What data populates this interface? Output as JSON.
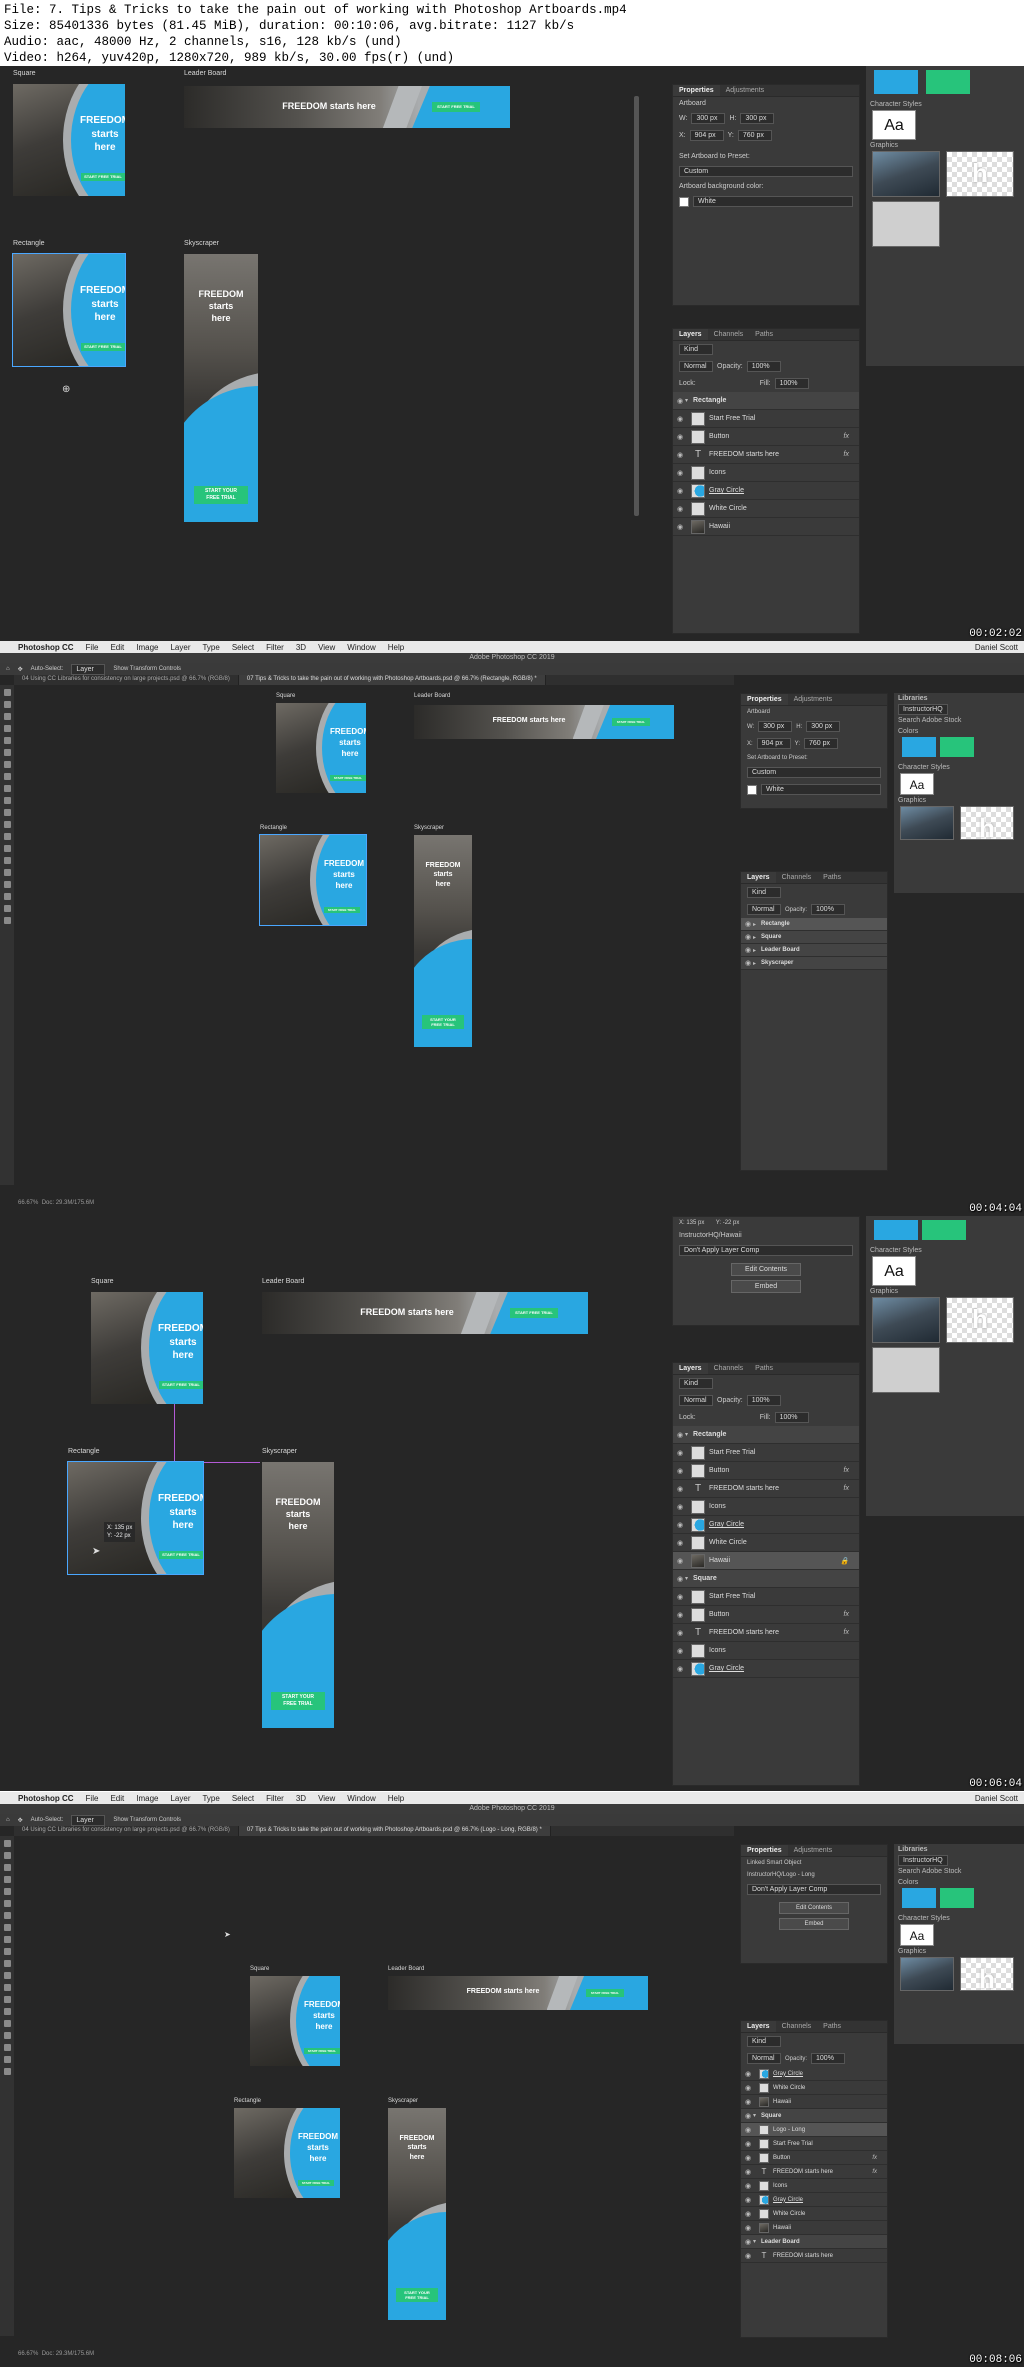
{
  "info": {
    "line1": "File: 7. Tips & Tricks to take the pain out of working with Photoshop Artboards.mp4",
    "line2": "Size: 85401336 bytes (81.45 MiB), duration: 00:10:06, avg.bitrate: 1127 kb/s",
    "line3": "Audio: aac, 48000 Hz, 2 channels, s16, 128 kb/s (und)",
    "line4": "Video: h264, yuv420p, 1280x720, 989 kb/s, 30.00 fps(r) (und)"
  },
  "menubar": {
    "app": "Photoshop CC",
    "items": [
      "File",
      "Edit",
      "Image",
      "Layer",
      "Type",
      "Select",
      "Filter",
      "3D",
      "View",
      "Window",
      "Help"
    ],
    "user": "Daniel Scott"
  },
  "window_title": "Adobe Photoshop CC 2019",
  "doc_tabs": {
    "tab1": "04 Using CC Libraries for consistency on large projects.psd @ 66.7% (RGB/8)",
    "tab2_frame2": "07 Tips & Tricks to take the pain out of working with Photoshop Artboards.psd @ 66.7% (Rectangle, RGB/8) *",
    "tab2_frame4": "07 Tips & Tricks to take the pain out of working with Photoshop Artboards.psd @ 66.7% (Logo - Long, RGB/8) *"
  },
  "options_bar": {
    "auto_select": "Auto-Select:",
    "layer": "Layer",
    "show_transform": "Show Transform Controls"
  },
  "artboards": {
    "square_label": "Square",
    "leader_label": "Leader Board",
    "rectangle_label": "Rectangle",
    "skyscraper_label": "Skyscraper",
    "headline_l1": "FREEDOM",
    "headline_l2": "starts",
    "headline_l3": "here",
    "leader_headline": "FREEDOM starts here",
    "small_button": "START FREE TRIAL",
    "sky_button_l1": "START YOUR",
    "sky_button_l2": "FREE TRIAL"
  },
  "properties": {
    "tabs": [
      "Properties",
      "Adjustments"
    ],
    "type": "Artboard",
    "w_label": "W:",
    "w_value": "300 px",
    "h_label": "H:",
    "h_value": "300 px",
    "x_label": "X:",
    "x_value": "904 px",
    "y_label": "Y:",
    "y_value": "760 px",
    "preset_label": "Set Artboard to Preset:",
    "preset_value": "Custom",
    "bg_label": "Artboard background color:",
    "bg_value": "White",
    "smart_object": "Linked Smart Object",
    "instructor": "InstructorHQ/Hawaii",
    "instructor_logo": "InstructorHQ/Logo - Long",
    "no_comp": "Don't Apply Layer Comp",
    "edit_contents": "Edit Contents",
    "embed": "Embed",
    "x_small": "X: 135 px",
    "y_small": "Y: -22 px"
  },
  "layers_panel": {
    "tabs": [
      "Layers",
      "Channels",
      "Paths"
    ],
    "kind": "Kind",
    "blend": "Normal",
    "opacity_label": "Opacity:",
    "opacity_value": "100%",
    "lock_label": "Lock:",
    "fill_label": "Fill:",
    "fill_value": "100%"
  },
  "layers": {
    "rectangle": "Rectangle",
    "square": "Square",
    "leader_board": "Leader Board",
    "skyscraper": "Skyscraper",
    "start_free_trial": "Start Free Trial",
    "button": "Button",
    "freedom_text": "FREEDOM starts here",
    "icons": "Icons",
    "gray_circle": "Gray Circle",
    "white_circle": "White Circle",
    "hawaii": "Hawaii",
    "logo_long": "Logo - Long"
  },
  "library": {
    "title": "Libraries",
    "name": "InstructorHQ",
    "search": "Search Adobe Stock",
    "colors": "Colors",
    "char_styles": "Character Styles",
    "graphics": "Graphics",
    "aa": "Aa"
  },
  "colors": {
    "blue": "#29a7e1",
    "green": "#27c47b"
  },
  "status": {
    "zoom": "66.67%",
    "doc": "Doc: 29.3M/175.6M"
  },
  "timecodes": [
    "00:02:02",
    "00:04:04",
    "00:06:04",
    "00:08:06"
  ]
}
